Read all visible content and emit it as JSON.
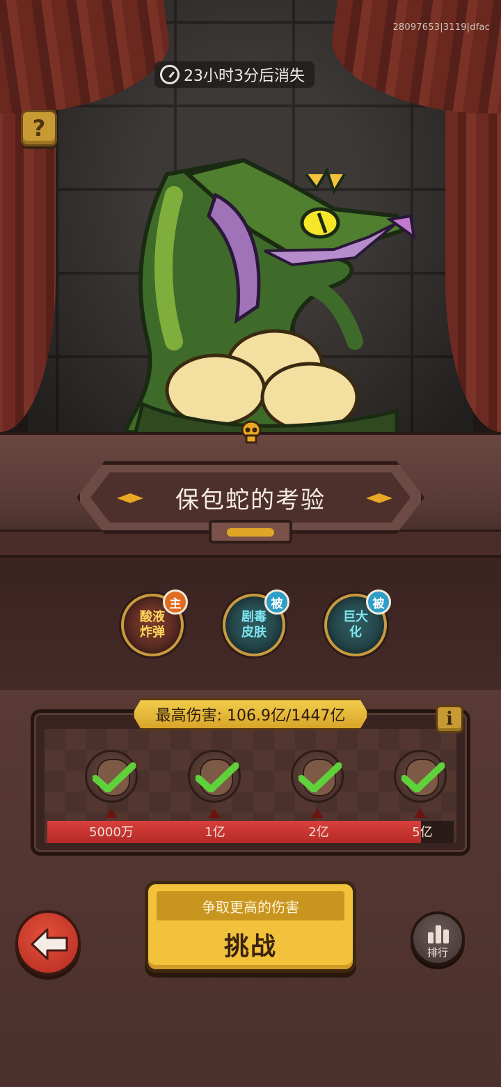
{
  "build_id": "28097653|3119|dfac",
  "timer": {
    "text": "23小时3分后消失"
  },
  "help": {
    "label": "?"
  },
  "boss": {
    "title": "保包蛇的考验"
  },
  "skills": [
    {
      "label": "酸液炸弹",
      "badge": "主",
      "kind": "main"
    },
    {
      "label": "剧毒皮肤",
      "badge": "被",
      "kind": "passive"
    },
    {
      "label": "巨大化",
      "badge": "被",
      "kind": "passive"
    }
  ],
  "damage": {
    "banner": "最高伤害: 106.9亿/1447亿",
    "info_label": "i",
    "progress_fraction": 0.92,
    "milestones": [
      {
        "label": "5000万",
        "claimed": true
      },
      {
        "label": "1亿",
        "claimed": true
      },
      {
        "label": "2亿",
        "claimed": true
      },
      {
        "label": "5亿",
        "claimed": true
      }
    ]
  },
  "challenge": {
    "subtitle": "争取更高的伤害",
    "label": "挑战"
  },
  "rank": {
    "label": "排行"
  },
  "colors": {
    "accent_gold": "#f2c23c",
    "progress_red": "#d8403c",
    "check_green": "#5fd13a"
  }
}
